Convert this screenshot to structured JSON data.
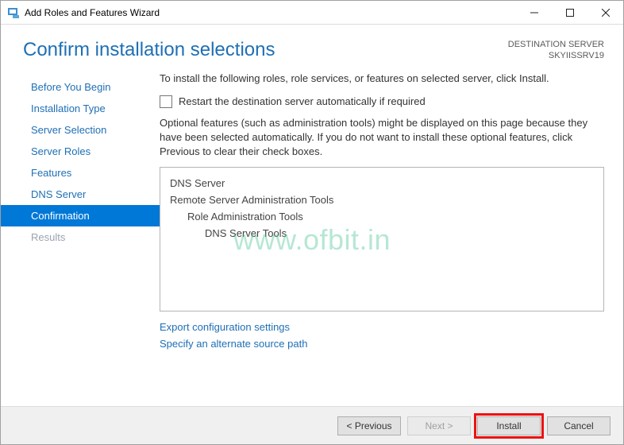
{
  "titlebar": {
    "title": "Add Roles and Features Wizard"
  },
  "header": {
    "page_title": "Confirm installation selections",
    "dest_label": "DESTINATION SERVER",
    "dest_server": "SKYIISSRV19"
  },
  "nav": {
    "items": [
      {
        "label": "Before You Begin",
        "state": "normal"
      },
      {
        "label": "Installation Type",
        "state": "normal"
      },
      {
        "label": "Server Selection",
        "state": "normal"
      },
      {
        "label": "Server Roles",
        "state": "normal"
      },
      {
        "label": "Features",
        "state": "normal"
      },
      {
        "label": "DNS Server",
        "state": "normal"
      },
      {
        "label": "Confirmation",
        "state": "selected"
      },
      {
        "label": "Results",
        "state": "disabled"
      }
    ]
  },
  "main": {
    "instruction": "To install the following roles, role services, or features on selected server, click Install.",
    "restart_checkbox_label": "Restart the destination server automatically if required",
    "optional_text": "Optional features (such as administration tools) might be displayed on this page because they have been selected automatically. If you do not want to install these optional features, click Previous to clear their check boxes.",
    "list": {
      "item0": "DNS Server",
      "item1": "Remote Server Administration Tools",
      "item2": "Role Administration Tools",
      "item3": "DNS Server Tools"
    },
    "link_export": "Export configuration settings",
    "link_source": "Specify an alternate source path"
  },
  "footer": {
    "previous": "< Previous",
    "next": "Next >",
    "install": "Install",
    "cancel": "Cancel"
  },
  "watermark": "www.ofbit.in"
}
